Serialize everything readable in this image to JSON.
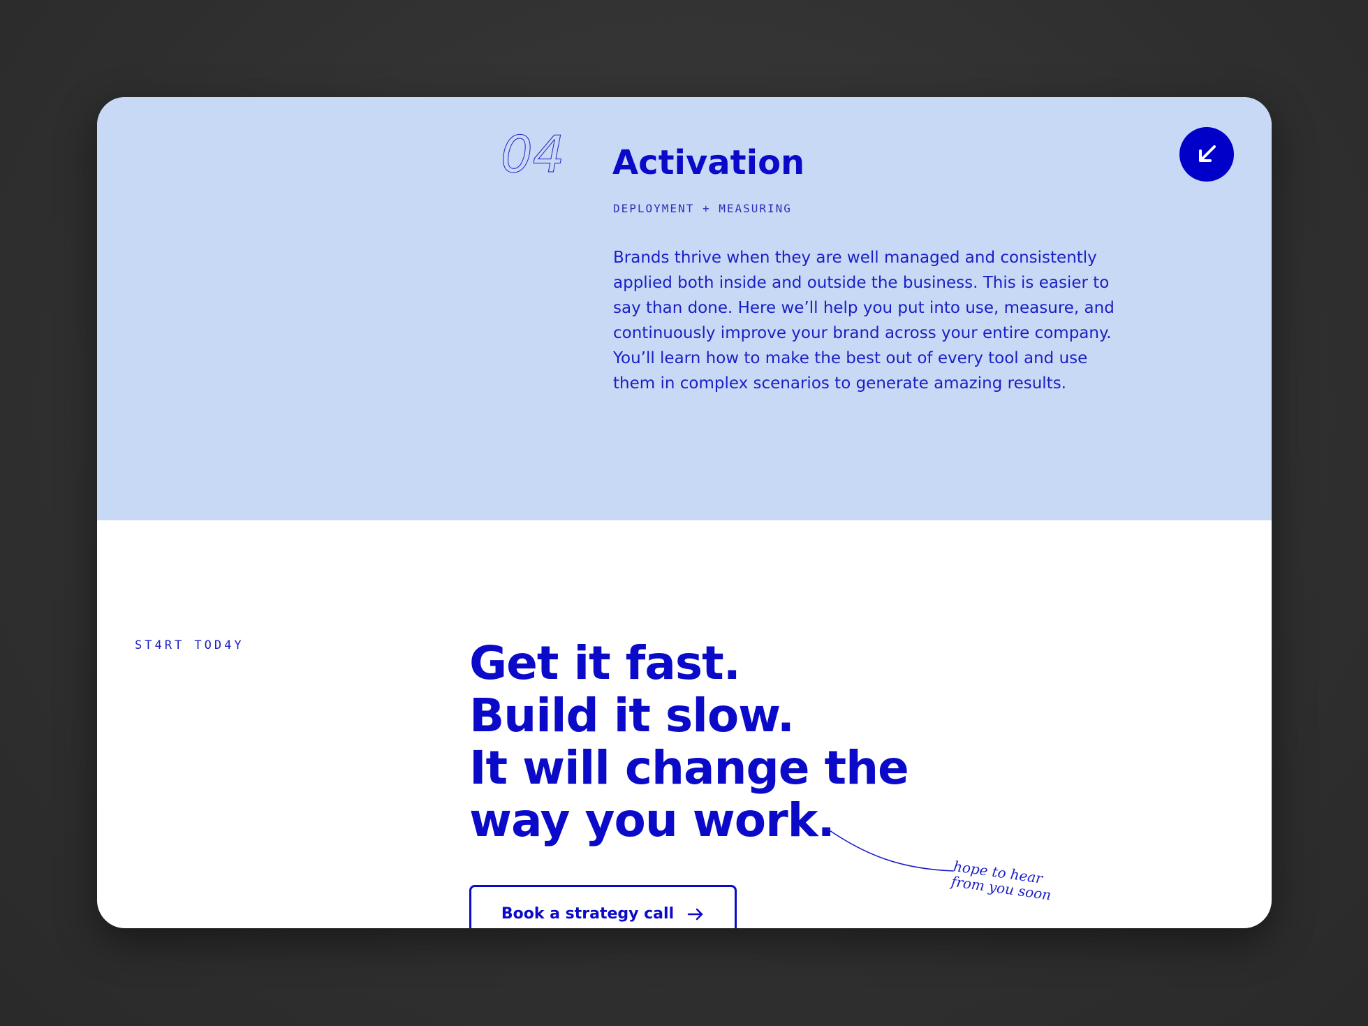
{
  "step": {
    "number": "04",
    "title": "Activation",
    "subtitle": "DEPLOYMENT + MEASURING",
    "body": "Brands thrive when they are well managed and consistently applied both inside and outside the business. This is easier to say than done. Here we’ll help you put into use, measure, and continuously improve your brand across your entire company. You’ll learn how to make the best out of every tool and use them in complex scenarios to generate amazing results.",
    "toggle_icon": "arrow-down-left-icon"
  },
  "cta_section": {
    "eyebrow": "ST4RT TOD4Y",
    "headline_lines": [
      "Get it fast.",
      "Build it slow.",
      "It will change the",
      "way you work."
    ],
    "button_label": "Book a strategy call",
    "button_icon": "arrow-right-icon",
    "handwritten_note_lines": [
      "hope to hear",
      "from you soon"
    ]
  },
  "colors": {
    "accent": "#0a0ac8",
    "top_panel": "#c8d9f6",
    "background": "#2e2e2e"
  }
}
